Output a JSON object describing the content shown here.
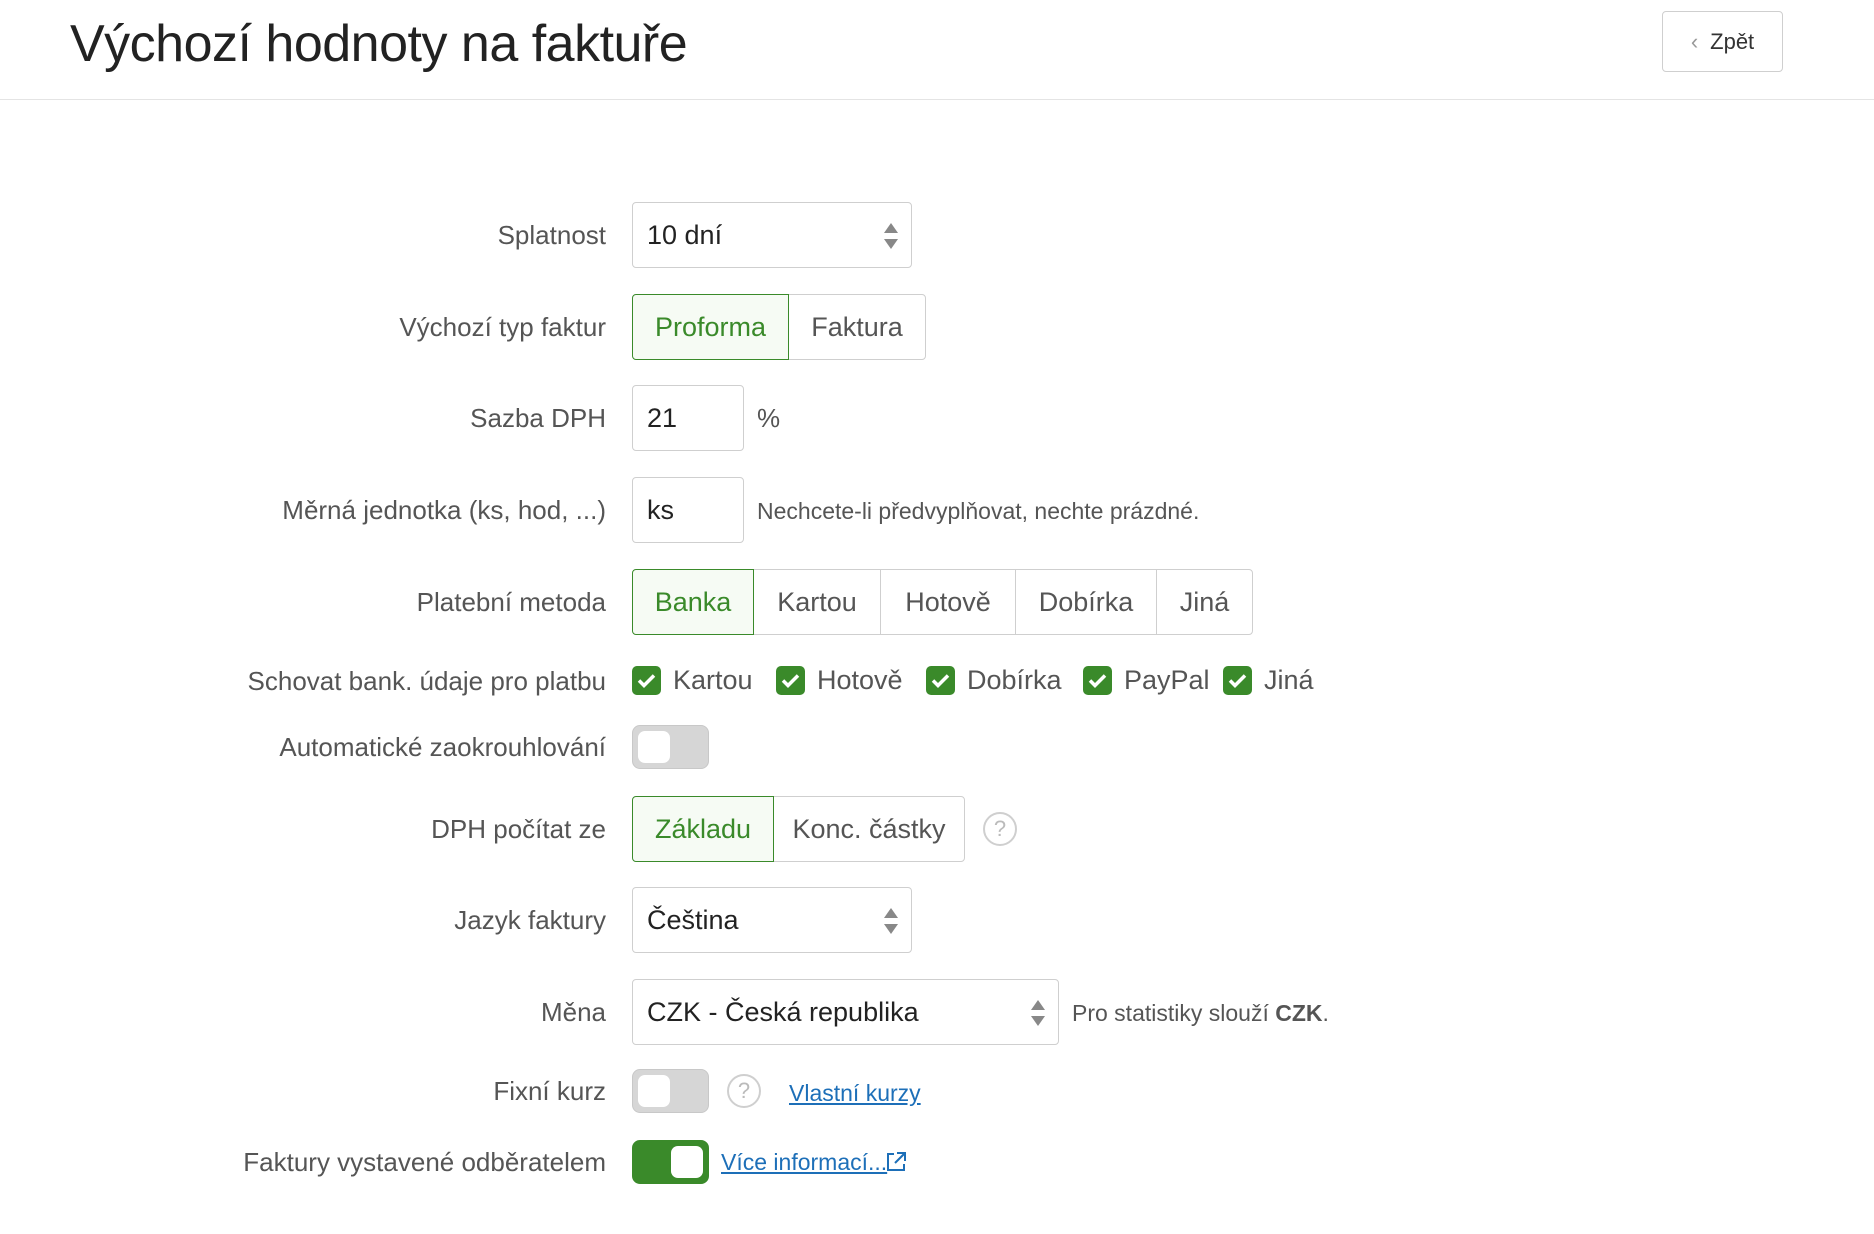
{
  "header": {
    "title": "Výchozí hodnoty na faktuře",
    "back_label": "Zpět"
  },
  "form": {
    "due": {
      "label": "Splatnost",
      "value": "10 dní"
    },
    "invoice_type": {
      "label": "Výchozí typ faktur",
      "options": [
        "Proforma",
        "Faktura"
      ],
      "selected": "Proforma"
    },
    "vat_rate": {
      "label": "Sazba DPH",
      "value": "21",
      "unit": "%"
    },
    "unit": {
      "label": "Měrná jednotka (ks, hod, ...)",
      "value": "ks",
      "hint": "Nechcete-li předvyplňovat, nechte prázdné."
    },
    "payment_method": {
      "label": "Platební metoda",
      "options": [
        "Banka",
        "Kartou",
        "Hotově",
        "Dobírka",
        "Jiná"
      ],
      "selected": "Banka"
    },
    "hide_bank": {
      "label": "Schovat bank. údaje pro platbu",
      "options": [
        "Kartou",
        "Hotově",
        "Dobírka",
        "PayPal",
        "Jiná"
      ],
      "checked": [
        true,
        true,
        true,
        true,
        true
      ]
    },
    "auto_rounding": {
      "label": "Automatické zaokrouhlování",
      "on": false
    },
    "vat_from": {
      "label": "DPH počítat ze",
      "options": [
        "Základu",
        "Konc. částky"
      ],
      "selected": "Základu",
      "help": "?"
    },
    "language": {
      "label": "Jazyk faktury",
      "value": "Čeština"
    },
    "currency": {
      "label": "Měna",
      "value": "CZK - Česká republika",
      "hint_prefix": "Pro statistiky slouží ",
      "hint_bold": "CZK",
      "hint_suffix": "."
    },
    "fixed_rate": {
      "label": "Fixní kurz",
      "on": false,
      "help": "?",
      "link": "Vlastní kurzy"
    },
    "self_billing": {
      "label": "Faktury vystavené odběratelem",
      "on": true,
      "link": "Více informací..."
    }
  },
  "colors": {
    "accent": "#3a8a2a",
    "link": "#1d6fb8",
    "border": "#cfcfcf"
  }
}
